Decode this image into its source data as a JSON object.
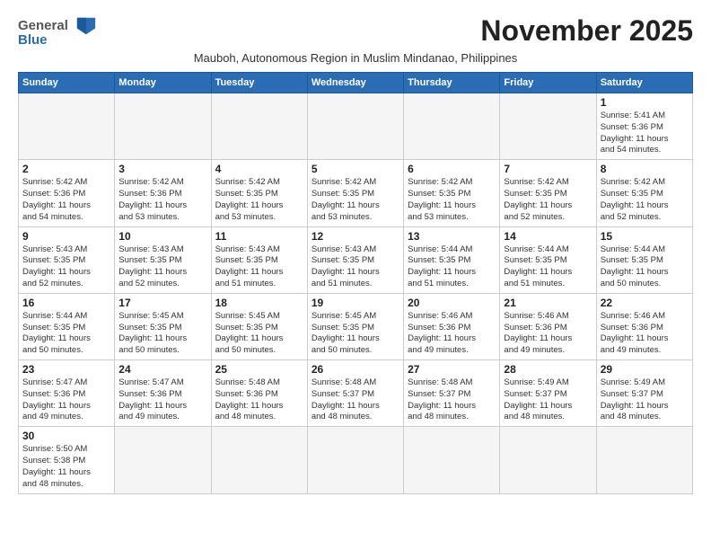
{
  "header": {
    "logo_line1": "General",
    "logo_line2": "Blue",
    "month_title": "November 2025",
    "subtitle": "Mauboh, Autonomous Region in Muslim Mindanao, Philippines"
  },
  "weekdays": [
    "Sunday",
    "Monday",
    "Tuesday",
    "Wednesday",
    "Thursday",
    "Friday",
    "Saturday"
  ],
  "weeks": [
    [
      {
        "day": "",
        "info": ""
      },
      {
        "day": "",
        "info": ""
      },
      {
        "day": "",
        "info": ""
      },
      {
        "day": "",
        "info": ""
      },
      {
        "day": "",
        "info": ""
      },
      {
        "day": "",
        "info": ""
      },
      {
        "day": "1",
        "info": "Sunrise: 5:41 AM\nSunset: 5:36 PM\nDaylight: 11 hours\nand 54 minutes."
      }
    ],
    [
      {
        "day": "2",
        "info": "Sunrise: 5:42 AM\nSunset: 5:36 PM\nDaylight: 11 hours\nand 54 minutes."
      },
      {
        "day": "3",
        "info": "Sunrise: 5:42 AM\nSunset: 5:36 PM\nDaylight: 11 hours\nand 53 minutes."
      },
      {
        "day": "4",
        "info": "Sunrise: 5:42 AM\nSunset: 5:35 PM\nDaylight: 11 hours\nand 53 minutes."
      },
      {
        "day": "5",
        "info": "Sunrise: 5:42 AM\nSunset: 5:35 PM\nDaylight: 11 hours\nand 53 minutes."
      },
      {
        "day": "6",
        "info": "Sunrise: 5:42 AM\nSunset: 5:35 PM\nDaylight: 11 hours\nand 53 minutes."
      },
      {
        "day": "7",
        "info": "Sunrise: 5:42 AM\nSunset: 5:35 PM\nDaylight: 11 hours\nand 52 minutes."
      },
      {
        "day": "8",
        "info": "Sunrise: 5:42 AM\nSunset: 5:35 PM\nDaylight: 11 hours\nand 52 minutes."
      }
    ],
    [
      {
        "day": "9",
        "info": "Sunrise: 5:43 AM\nSunset: 5:35 PM\nDaylight: 11 hours\nand 52 minutes."
      },
      {
        "day": "10",
        "info": "Sunrise: 5:43 AM\nSunset: 5:35 PM\nDaylight: 11 hours\nand 52 minutes."
      },
      {
        "day": "11",
        "info": "Sunrise: 5:43 AM\nSunset: 5:35 PM\nDaylight: 11 hours\nand 51 minutes."
      },
      {
        "day": "12",
        "info": "Sunrise: 5:43 AM\nSunset: 5:35 PM\nDaylight: 11 hours\nand 51 minutes."
      },
      {
        "day": "13",
        "info": "Sunrise: 5:44 AM\nSunset: 5:35 PM\nDaylight: 11 hours\nand 51 minutes."
      },
      {
        "day": "14",
        "info": "Sunrise: 5:44 AM\nSunset: 5:35 PM\nDaylight: 11 hours\nand 51 minutes."
      },
      {
        "day": "15",
        "info": "Sunrise: 5:44 AM\nSunset: 5:35 PM\nDaylight: 11 hours\nand 50 minutes."
      }
    ],
    [
      {
        "day": "16",
        "info": "Sunrise: 5:44 AM\nSunset: 5:35 PM\nDaylight: 11 hours\nand 50 minutes."
      },
      {
        "day": "17",
        "info": "Sunrise: 5:45 AM\nSunset: 5:35 PM\nDaylight: 11 hours\nand 50 minutes."
      },
      {
        "day": "18",
        "info": "Sunrise: 5:45 AM\nSunset: 5:35 PM\nDaylight: 11 hours\nand 50 minutes."
      },
      {
        "day": "19",
        "info": "Sunrise: 5:45 AM\nSunset: 5:35 PM\nDaylight: 11 hours\nand 50 minutes."
      },
      {
        "day": "20",
        "info": "Sunrise: 5:46 AM\nSunset: 5:36 PM\nDaylight: 11 hours\nand 49 minutes."
      },
      {
        "day": "21",
        "info": "Sunrise: 5:46 AM\nSunset: 5:36 PM\nDaylight: 11 hours\nand 49 minutes."
      },
      {
        "day": "22",
        "info": "Sunrise: 5:46 AM\nSunset: 5:36 PM\nDaylight: 11 hours\nand 49 minutes."
      }
    ],
    [
      {
        "day": "23",
        "info": "Sunrise: 5:47 AM\nSunset: 5:36 PM\nDaylight: 11 hours\nand 49 minutes."
      },
      {
        "day": "24",
        "info": "Sunrise: 5:47 AM\nSunset: 5:36 PM\nDaylight: 11 hours\nand 49 minutes."
      },
      {
        "day": "25",
        "info": "Sunrise: 5:48 AM\nSunset: 5:36 PM\nDaylight: 11 hours\nand 48 minutes."
      },
      {
        "day": "26",
        "info": "Sunrise: 5:48 AM\nSunset: 5:37 PM\nDaylight: 11 hours\nand 48 minutes."
      },
      {
        "day": "27",
        "info": "Sunrise: 5:48 AM\nSunset: 5:37 PM\nDaylight: 11 hours\nand 48 minutes."
      },
      {
        "day": "28",
        "info": "Sunrise: 5:49 AM\nSunset: 5:37 PM\nDaylight: 11 hours\nand 48 minutes."
      },
      {
        "day": "29",
        "info": "Sunrise: 5:49 AM\nSunset: 5:37 PM\nDaylight: 11 hours\nand 48 minutes."
      }
    ],
    [
      {
        "day": "30",
        "info": "Sunrise: 5:50 AM\nSunset: 5:38 PM\nDaylight: 11 hours\nand 48 minutes."
      },
      {
        "day": "",
        "info": ""
      },
      {
        "day": "",
        "info": ""
      },
      {
        "day": "",
        "info": ""
      },
      {
        "day": "",
        "info": ""
      },
      {
        "day": "",
        "info": ""
      },
      {
        "day": "",
        "info": ""
      }
    ]
  ]
}
